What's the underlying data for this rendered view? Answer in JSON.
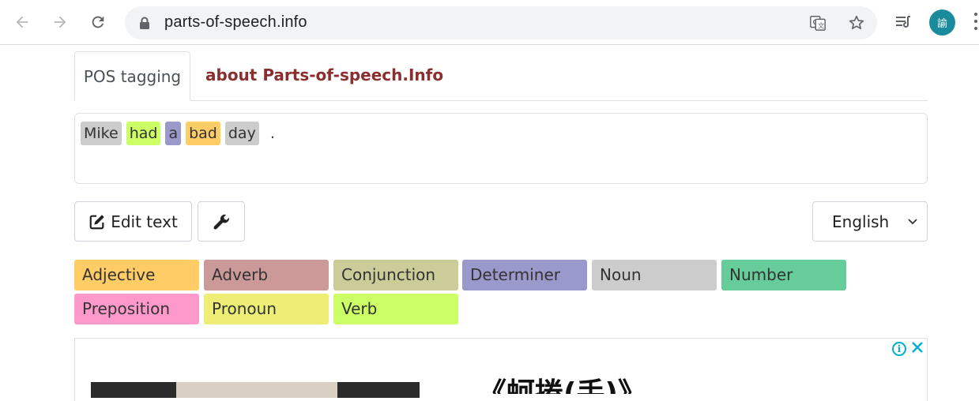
{
  "browser": {
    "url": "parts-of-speech.info",
    "avatar_text": "諭"
  },
  "tabs": {
    "active": "POS tagging",
    "other": "about Parts-of-speech.Info"
  },
  "tagged_tokens": [
    {
      "text": "Mike",
      "pos": "Noun",
      "color": "#cccccc"
    },
    {
      "text": "had",
      "pos": "Verb",
      "color": "#ccff66"
    },
    {
      "text": "a",
      "pos": "Determiner",
      "color": "#9999cc"
    },
    {
      "text": "bad",
      "pos": "Adjective",
      "color": "#ffcc66"
    },
    {
      "text": "day",
      "pos": "Noun",
      "color": "#cccccc"
    },
    {
      "text": ".",
      "pos": "",
      "color": "transparent"
    }
  ],
  "controls": {
    "edit_text_label": "Edit text",
    "language_selected": "English"
  },
  "legend": [
    {
      "label": "Adjective",
      "color": "#ffcc66"
    },
    {
      "label": "Adverb",
      "color": "#cc9999"
    },
    {
      "label": "Conjunction",
      "color": "#cccc99"
    },
    {
      "label": "Determiner",
      "color": "#9999cc"
    },
    {
      "label": "Noun",
      "color": "#cccccc"
    },
    {
      "label": "Number",
      "color": "#66cc99"
    },
    {
      "label": "Preposition",
      "color": "#ff99cc"
    },
    {
      "label": "Pronoun",
      "color": "#eeee77"
    },
    {
      "label": "Verb",
      "color": "#ccff66"
    }
  ],
  "ad": {
    "headline": "《蚵捲(手)》"
  }
}
